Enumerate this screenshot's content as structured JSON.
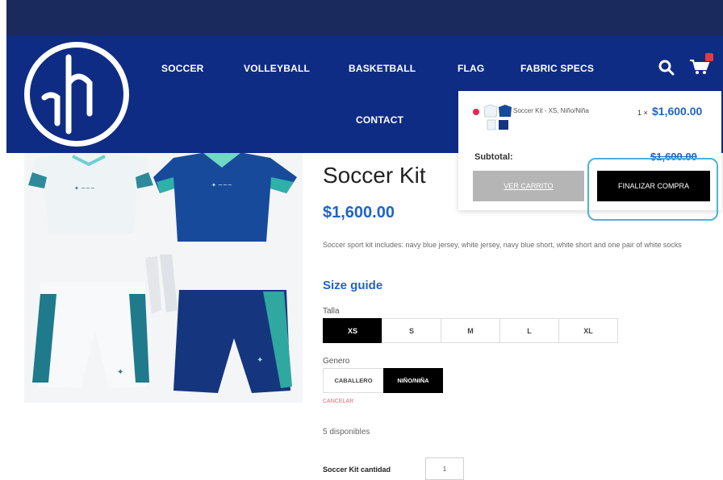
{
  "nav": {
    "items": [
      "SOCCER",
      "VOLLEYBALL",
      "BASKETBALL",
      "FLAG",
      "FABRIC SPECS",
      "CONTACT"
    ]
  },
  "product": {
    "title": "Soccer Kit",
    "price": "$1,600.00",
    "description": "Soccer sport kit includes: navy blue jersey, white jersey, navy blue short, white short and one pair of white socks",
    "size_guide": "Size guide",
    "size_label": "Talla",
    "sizes": [
      "XS",
      "S",
      "M",
      "L",
      "XL"
    ],
    "selected_size": "XS",
    "gender_label": "Genero",
    "genders": [
      "CABALLERO",
      "NIÑO/NIÑA"
    ],
    "selected_gender": "NIÑO/NIÑA",
    "clear_label": "CANCELAR",
    "stock": "5 disponibles",
    "qty_label": "Soccer Kit cantidad",
    "qty_value": "1"
  },
  "mini_cart": {
    "item_name": "Soccer Kit - XS, Niño/Niña",
    "item_qty": "1 ×",
    "item_price": "$1,600.00",
    "subtotal_label": "Subtotal:",
    "subtotal_value": "$1,600.00",
    "view_cart": "VER CARRITO",
    "checkout": "FINALIZAR COMPRA"
  },
  "colors": {
    "header_navy": "#0f2c84",
    "accent_blue": "#1f63c8",
    "highlight": "#4ab3d8"
  },
  "icons": [
    "logo-icon",
    "search-icon",
    "cart-icon"
  ]
}
